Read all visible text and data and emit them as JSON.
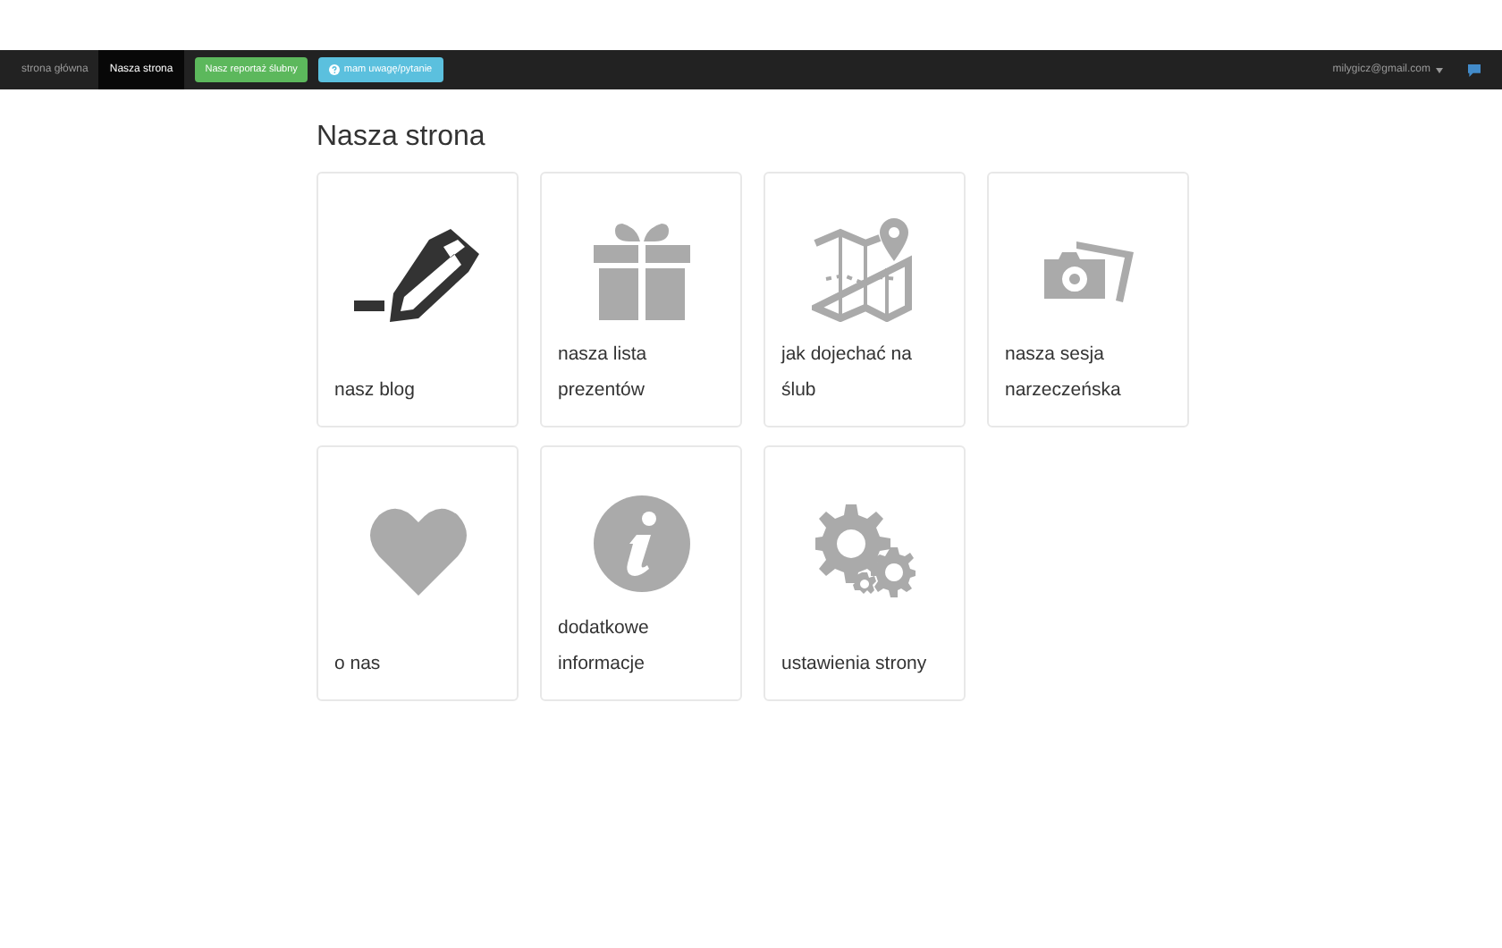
{
  "navbar": {
    "links": [
      {
        "label": "strona główna",
        "selected": false
      },
      {
        "label": "Nasza strona",
        "selected": true
      }
    ],
    "buttons": [
      {
        "label": "Nasz reportaż ślubny",
        "kind": "success"
      },
      {
        "label": "mam uwagę/pytanie",
        "kind": "info"
      }
    ],
    "account": "milygicz@gmail.com"
  },
  "heading": "Nasza strona",
  "tiles": [
    {
      "label": "nasz blog",
      "kind": "pencil"
    },
    {
      "label": "nasza lista prezentów",
      "kind": "gift"
    },
    {
      "label": "jak dojechać na ślub",
      "kind": "map"
    },
    {
      "label": "nasza sesja narzeczeńska",
      "kind": "camera"
    },
    {
      "label": "o nas",
      "kind": "heart"
    },
    {
      "label": "dodatkowe informacje",
      "kind": "info"
    },
    {
      "label": "ustawienia strony",
      "kind": "gears"
    }
  ]
}
